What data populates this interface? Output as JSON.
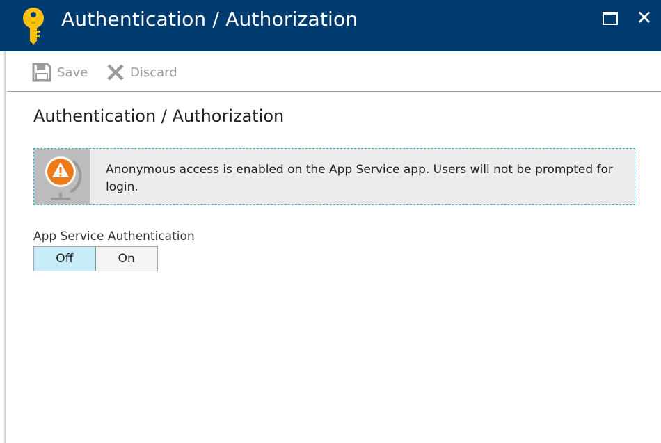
{
  "header": {
    "title": "Authentication / Authorization",
    "icon": "key-icon",
    "maximize_icon": "maximize-icon",
    "close_glyph": "✕"
  },
  "toolbar": {
    "save_label": "Save",
    "discard_label": "Discard"
  },
  "content": {
    "title": "Authentication / Authorization"
  },
  "warning": {
    "icon": "warning-globe-icon",
    "message": "Anonymous access is enabled on the App Service app. Users will not be prompted for login."
  },
  "auth_setting": {
    "label": "App Service Authentication",
    "options": [
      "Off",
      "On"
    ],
    "selected": "Off"
  },
  "colors": {
    "header_bg": "#003b6f",
    "key_yellow": "#f8c20c",
    "warning_orange": "#ef7a1a",
    "warning_border": "#2bb3d6",
    "selected_option_bg": "#c7ecf8"
  }
}
